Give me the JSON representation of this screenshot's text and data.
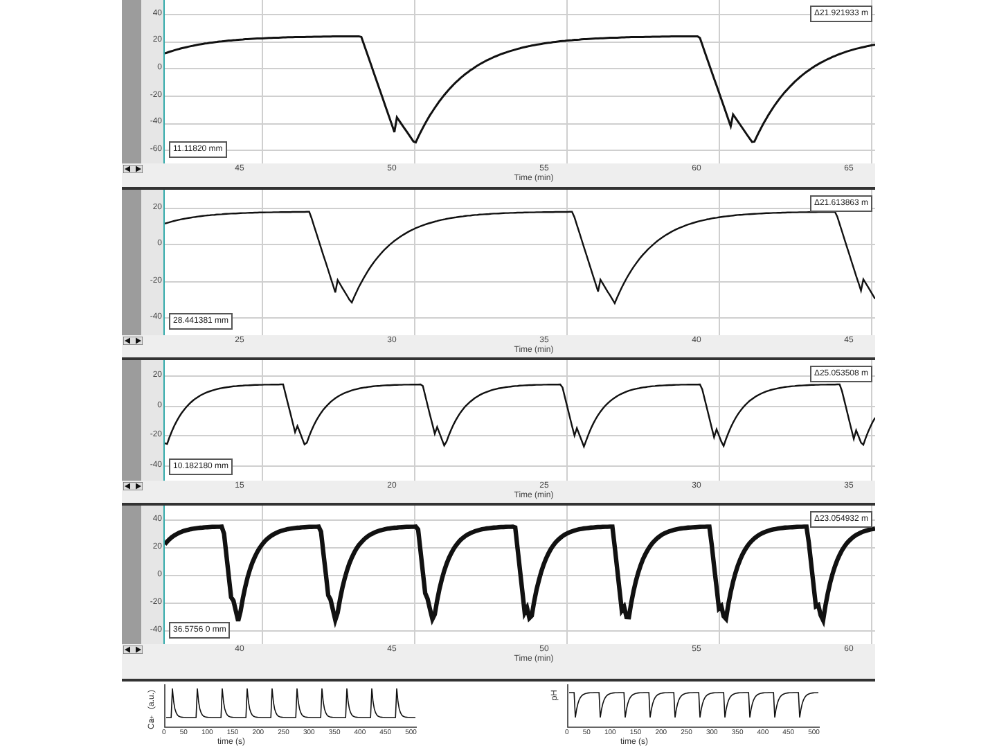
{
  "panels": [
    {
      "y_ticks": [
        "40",
        "20",
        "0",
        "-20",
        "-40",
        "-60"
      ],
      "x_ticks": [
        "45",
        "50",
        "55",
        "60",
        "65"
      ],
      "x_label": "Time (min)",
      "readout_left": "11.11820 mm",
      "readout_right": "Δ21.921933 m"
    },
    {
      "y_ticks": [
        "20",
        "0",
        "-20",
        "-40"
      ],
      "x_ticks": [
        "25",
        "30",
        "35",
        "40",
        "45"
      ],
      "x_label": "Time (min)",
      "readout_left": "28.441381 mm",
      "readout_right": "Δ21.613863 m"
    },
    {
      "y_ticks": [
        "20",
        "0",
        "-20",
        "-40"
      ],
      "x_ticks": [
        "15",
        "20",
        "25",
        "30",
        "35"
      ],
      "x_label": "Time (min)",
      "readout_left": "10.182180 mm",
      "readout_right": "Δ25.053508 m"
    },
    {
      "y_ticks": [
        "40",
        "20",
        "0",
        "-20",
        "-40"
      ],
      "x_ticks": [
        "40",
        "45",
        "50",
        "55",
        "60"
      ],
      "x_label": "Time (min)",
      "readout_left": "36.5756 0 mm",
      "readout_right": "Δ23.054932 m"
    }
  ],
  "small_charts": [
    {
      "kind": "spikes",
      "y_label": "Ca$^{2+}$ (a.u.)",
      "x_label": "time (s)",
      "x_ticks": [
        "0",
        "50",
        "100",
        "150",
        "200",
        "250",
        "300",
        "350",
        "400",
        "450",
        "500"
      ]
    },
    {
      "kind": "dips",
      "y_label": "pH",
      "x_label": "time (s)",
      "x_ticks": [
        "0",
        "50",
        "100",
        "150",
        "200",
        "250",
        "300",
        "350",
        "400",
        "450",
        "500"
      ]
    }
  ]
}
